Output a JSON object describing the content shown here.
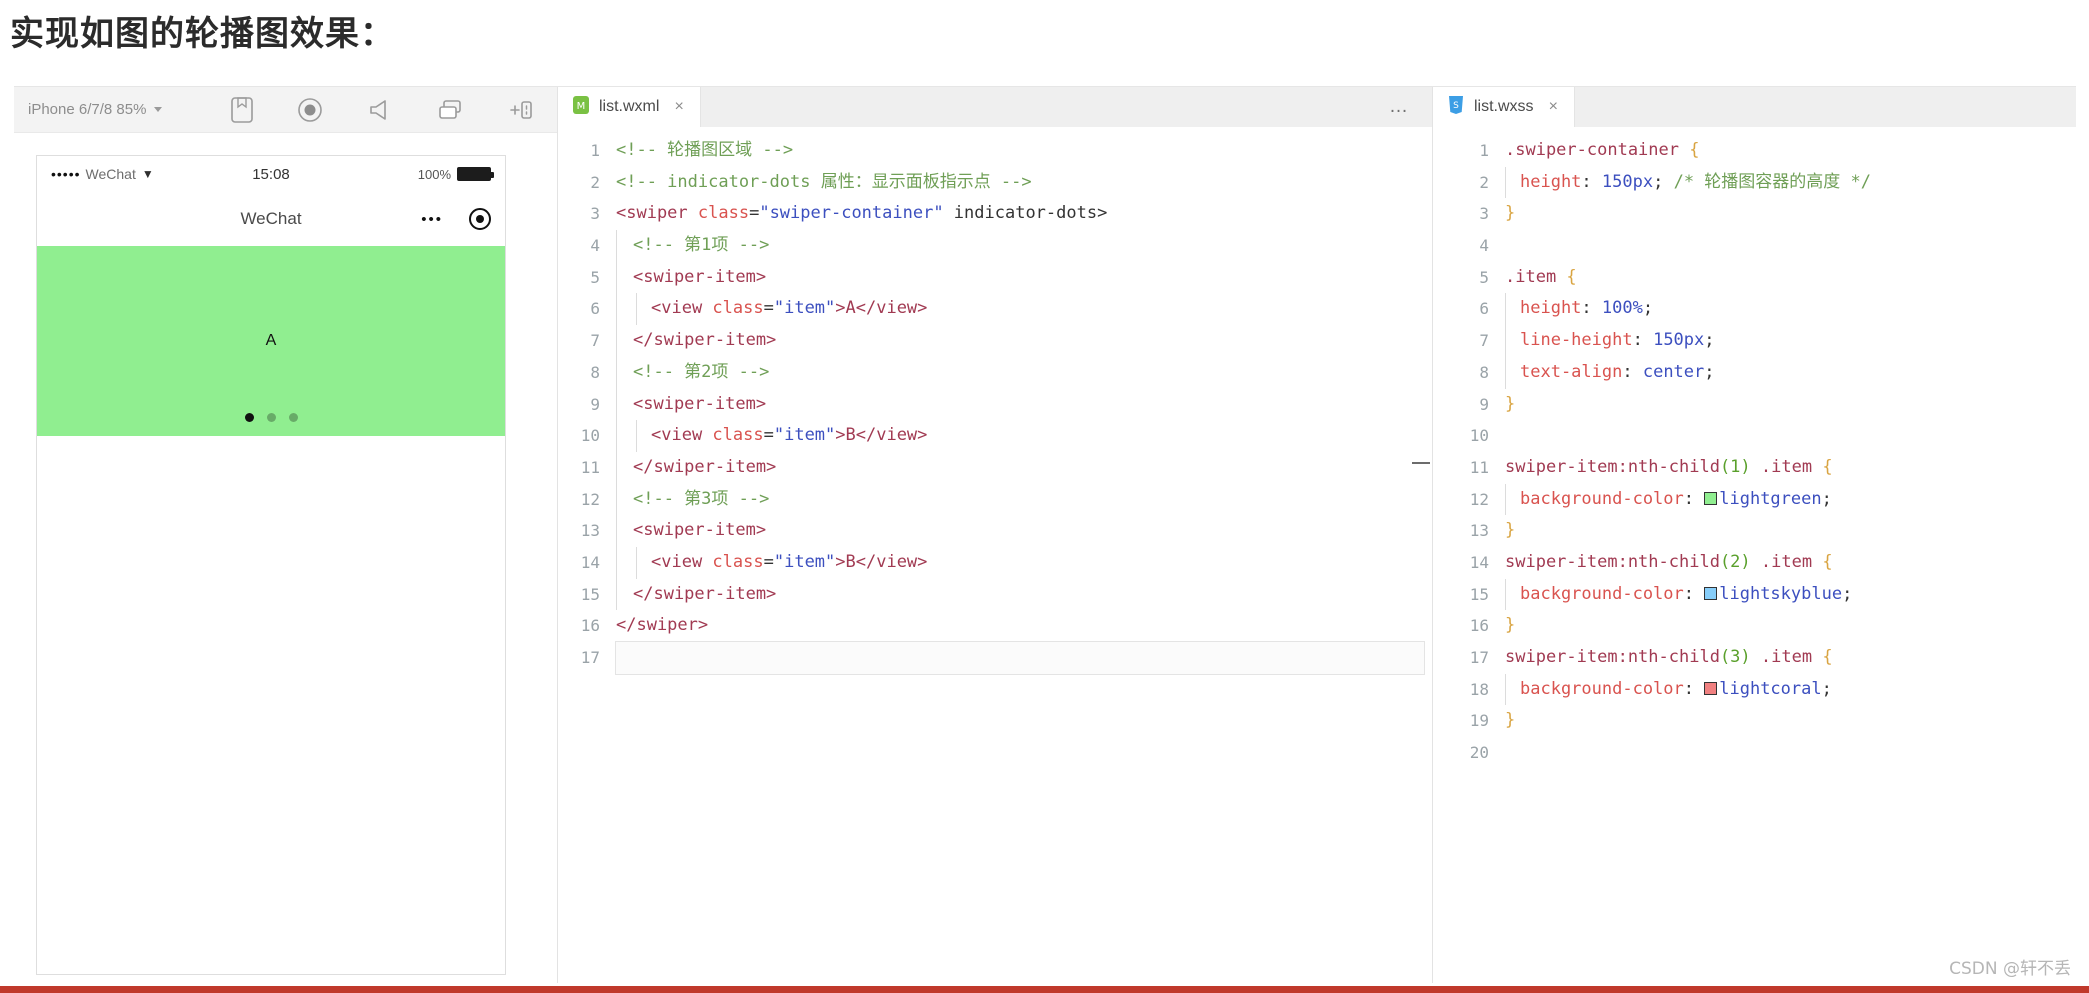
{
  "page": {
    "heading": "实现如图的轮播图效果：",
    "watermark": "CSDN @轩不丢"
  },
  "simulator": {
    "device_label": "iPhone 6/7/8 85%",
    "toolbar_icons": [
      "phone-frame-icon",
      "record-icon",
      "megaphone-icon",
      "window-split-icon",
      "add-panel-icon"
    ],
    "phone": {
      "status": {
        "signal_dots": "•••••",
        "carrier": "WeChat",
        "wifi": "wifi-icon",
        "time": "15:08",
        "battery_percent": "100%"
      },
      "nav": {
        "title": "WeChat",
        "capsule_more": "•••",
        "capsule_target": "target-icon"
      },
      "swiper": {
        "letter": "A",
        "background": "#90ee90",
        "dots_count": 3,
        "active_dot": 1
      }
    }
  },
  "wxml_pane": {
    "tab": {
      "filename": "list.wxml",
      "icon": "wxml-file-icon",
      "close": "×"
    },
    "more": "…",
    "lines": [
      {
        "n": "1",
        "indent": 0
      },
      {
        "n": "2",
        "indent": 0
      },
      {
        "n": "3",
        "indent": 0
      },
      {
        "n": "4",
        "indent": 1
      },
      {
        "n": "5",
        "indent": 1
      },
      {
        "n": "6",
        "indent": 2
      },
      {
        "n": "7",
        "indent": 1
      },
      {
        "n": "8",
        "indent": 1
      },
      {
        "n": "9",
        "indent": 1
      },
      {
        "n": "10",
        "indent": 2
      },
      {
        "n": "11",
        "indent": 1
      },
      {
        "n": "12",
        "indent": 1
      },
      {
        "n": "13",
        "indent": 1
      },
      {
        "n": "14",
        "indent": 2
      },
      {
        "n": "15",
        "indent": 1
      },
      {
        "n": "16",
        "indent": 0
      },
      {
        "n": "17",
        "indent": 0
      }
    ],
    "text": {
      "l1": "<!-- 轮播图区域 -->",
      "l2": "<!-- indicator-dots 属性：显示面板指示点 -->",
      "l3_a": "<swiper ",
      "l3_b": "class",
      "l3_c": "=",
      "l3_d": "\"swiper-container\"",
      "l3_e": " indicator-dots>",
      "l4": "<!-- 第1项 -->",
      "l5": "<swiper-item>",
      "l6_a": "<view ",
      "l6_b": "class",
      "l6_c": "=",
      "l6_d": "\"item\"",
      "l6_e": ">A</view>",
      "l7": "</swiper-item>",
      "l8": "<!-- 第2项 -->",
      "l9": "<swiper-item>",
      "l10_a": "<view ",
      "l10_b": "class",
      "l10_c": "=",
      "l10_d": "\"item\"",
      "l10_e": ">B</view>",
      "l11": "</swiper-item>",
      "l12": "<!-- 第3项 -->",
      "l13": "<swiper-item>",
      "l14_a": "<view ",
      "l14_b": "class",
      "l14_c": "=",
      "l14_d": "\"item\"",
      "l14_e": ">B</view>",
      "l15": "</swiper-item>",
      "l16": "</swiper>",
      "l17": ""
    }
  },
  "wxss_pane": {
    "tab": {
      "filename": "list.wxss",
      "icon": "wxss-file-icon",
      "close": "×"
    },
    "lines": [
      {
        "n": "1"
      },
      {
        "n": "2"
      },
      {
        "n": "3"
      },
      {
        "n": "4"
      },
      {
        "n": "5"
      },
      {
        "n": "6"
      },
      {
        "n": "7"
      },
      {
        "n": "8"
      },
      {
        "n": "9"
      },
      {
        "n": "10"
      },
      {
        "n": "11"
      },
      {
        "n": "12"
      },
      {
        "n": "13"
      },
      {
        "n": "14"
      },
      {
        "n": "15"
      },
      {
        "n": "16"
      },
      {
        "n": "17"
      },
      {
        "n": "18"
      },
      {
        "n": "19"
      },
      {
        "n": "20"
      }
    ],
    "text": {
      "l1_sel": ".swiper-container ",
      "l1_brace": "{",
      "l2_prop": "height",
      "l2_colon": ": ",
      "l2_val": "150px",
      "l2_semi": ";",
      "l2_cmt": " /* 轮播图容器的高度 */",
      "l3": "}",
      "l5_sel": ".item ",
      "l5_brace": "{",
      "l6_prop": "height",
      "l6_val": "100%",
      "l7_prop": "line-height",
      "l7_val": "150px",
      "l8_prop": "text-align",
      "l8_val": "center",
      "l9": "}",
      "l11_sel": "swiper-item:nth-child",
      "l11_arg": "(1)",
      "l11_sel2": " .item ",
      "l11_brace": "{",
      "l12_prop": "background-color",
      "l12_val": "lightgreen",
      "l12_swatch": "#90ee90",
      "l13": "}",
      "l14_sel": "swiper-item:nth-child",
      "l14_arg": "(2)",
      "l14_sel2": " .item ",
      "l14_brace": "{",
      "l15_prop": "background-color",
      "l15_val": "lightskyblue",
      "l15_swatch": "#87cefa",
      "l16": "}",
      "l17_sel": "swiper-item:nth-child",
      "l17_arg": "(3)",
      "l17_sel2": " .item ",
      "l17_brace": "{",
      "l18_prop": "background-color",
      "l18_val": "lightcoral",
      "l18_swatch": "#f08080",
      "l19": "}",
      "l20": ""
    }
  },
  "colors": {
    "accent_green": "#90ee90",
    "accent_blue": "#87cefa",
    "accent_coral": "#f08080",
    "bottom_bar": "#c0392b"
  }
}
